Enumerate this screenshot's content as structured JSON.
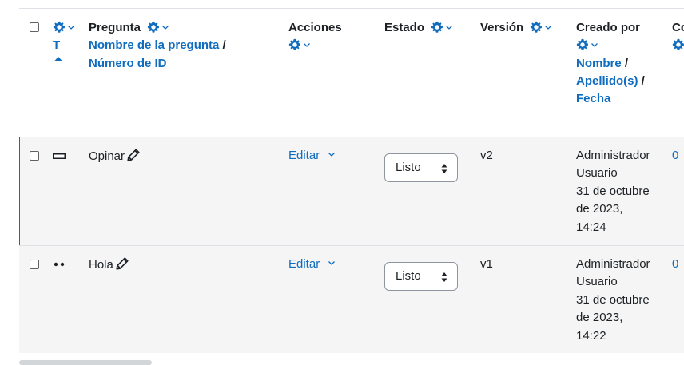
{
  "table": {
    "headers": {
      "type_sort": "T",
      "question_title": "Pregunta",
      "question_name_link": "Nombre de la pregunta",
      "question_id_link": "Número de ID",
      "separator": "/",
      "actions": "Acciones",
      "status": "Estado",
      "version": "Versión",
      "created_by": "Creado por",
      "first_name_link": "Nombre",
      "last_name_link": "Apellido(s)",
      "date_link": "Fecha",
      "comments_partial": "Co"
    },
    "rows": [
      {
        "question": "Opinar",
        "action_label": "Editar",
        "status": "Listo",
        "version": "v2",
        "creator_first": "Administrador",
        "creator_last": "Usuario",
        "date_line1": "31 de octubre",
        "date_line2": "de 2023,",
        "time": "14:24",
        "comments": "0"
      },
      {
        "question": "Hola",
        "action_label": "Editar",
        "status": "Listo",
        "version": "v1",
        "creator_first": "Administrador",
        "creator_last": "Usuario",
        "date_line1": "31 de octubre",
        "date_line2": "de 2023,",
        "time": "14:22",
        "comments": "0"
      }
    ]
  },
  "colors": {
    "link": "#0f6cbf",
    "row_background": "#f5f5f5",
    "text": "#1d2125"
  },
  "icons": {
    "settings": "gear-icon",
    "dropdown": "chevron-down-icon",
    "edit": "pencil-icon",
    "sort": "caret-up-icon",
    "type_essay": "essay-type-icon",
    "type_truefalse": "truefalse-type-icon"
  }
}
